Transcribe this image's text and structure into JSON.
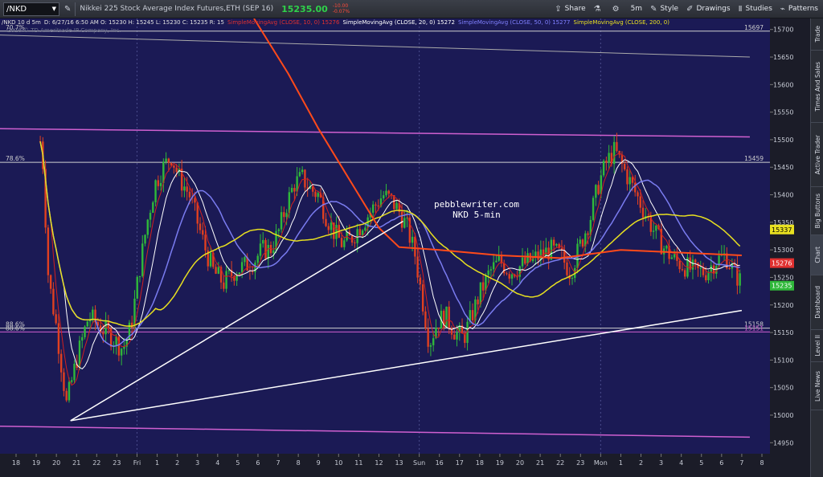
{
  "toolbar": {
    "symbol": "/NKD",
    "description": "Nikkei 225 Stock Average Index Futures,ETH (SEP 16)",
    "last_price": "15235.00",
    "change_abs": "-10.00",
    "change_pct": "-0.07%",
    "buttons": [
      {
        "icon": "share-icon",
        "glyph": "⇪",
        "label": "Share"
      },
      {
        "icon": "flask-icon",
        "glyph": "⚗",
        "label": ""
      },
      {
        "icon": "gear-icon",
        "glyph": "⚙",
        "label": ""
      },
      {
        "icon": "timeframe-icon",
        "glyph": "",
        "label": "5m"
      },
      {
        "icon": "style-icon",
        "glyph": "✎",
        "label": "Style"
      },
      {
        "icon": "drawings-icon",
        "glyph": "✐",
        "label": "Drawings"
      },
      {
        "icon": "studies-icon",
        "glyph": "Ⅱ",
        "label": "Studies"
      },
      {
        "icon": "patterns-icon",
        "glyph": "⌁",
        "label": "Patterns"
      }
    ]
  },
  "side_tabs": [
    "Trade",
    "Times And Sales",
    "Active Trader",
    "Big Buttons",
    "Chart",
    "Dashboard",
    "Level II",
    "Live News"
  ],
  "legend": {
    "prefix": "/NKD 10 d 5m",
    "ohlc": "D: 6/27/16 6:50 AM   O: 15230   H: 15245   L: 15230   C: 15235   R: 15",
    "studies": [
      {
        "label": "SimpleMovingAvg (CLOSE, 10, 0)",
        "value": "15276",
        "color": "#e03030"
      },
      {
        "label": "SimpleMovingAvg (CLOSE, 20, 0)",
        "value": "15272",
        "color": "#ffffff"
      },
      {
        "label": "SimpleMovingAvg (CLOSE, 50, 0)",
        "value": "15277",
        "color": "#8080ff"
      },
      {
        "label": "SimpleMovingAvg (CLOSE, 200, 0)",
        "value": "",
        "color": "#e8e020"
      }
    ],
    "copyright": "2016 © TD Ameritrade IP Company, Inc."
  },
  "watermark": {
    "line1": "pebblewriter.com",
    "line2": "NKD 5-min"
  },
  "colors": {
    "background": "#1b1a55",
    "grid": "#2c2e70",
    "up_candle": "#2fb83a",
    "down_candle": "#e04020",
    "sma200": "#ff4a1a",
    "sma50": "#e8e020",
    "sma20": "#7a7cf0",
    "sma10": "#ffffff",
    "sma5": "#d02020",
    "trendline": "#ffffff",
    "fib": "#aaaaaa",
    "magenta": "#d060d0"
  },
  "chart_data": {
    "type": "candlestick",
    "x_tick_labels": [
      "18",
      "19",
      "20",
      "21",
      "22",
      "23",
      "Fri",
      "1",
      "2",
      "3",
      "4",
      "5",
      "6",
      "7",
      "8",
      "9",
      "10",
      "11",
      "12",
      "13",
      "Sun",
      "16",
      "17",
      "18",
      "19",
      "20",
      "21",
      "22",
      "23",
      "Mon",
      "1",
      "2",
      "3",
      "4",
      "5",
      "6",
      "7",
      "8"
    ],
    "ylim": [
      14930,
      15720
    ],
    "y_ticks": [
      14950,
      15000,
      15050,
      15100,
      15150,
      15200,
      15250,
      15300,
      15350,
      15400,
      15450,
      15500,
      15550,
      15600,
      15650,
      15700
    ],
    "fib_levels": [
      {
        "label": "78.6%",
        "price": 15459,
        "price_label": "15459"
      },
      {
        "label": "88.6%",
        "price": 15158,
        "price_label": "15158"
      },
      {
        "label": "88.6%",
        "price": 15151,
        "price_label": "15151"
      },
      {
        "label": "70.7%",
        "price": 15697,
        "price_label": "15697"
      }
    ],
    "price_tags": [
      {
        "price": 15337,
        "label": "15337",
        "bg": "#e8e020",
        "fg": "#000000"
      },
      {
        "price": 15276,
        "label": "15276",
        "bg": "#e03030",
        "fg": "#ffffff"
      },
      {
        "price": 15235,
        "label": "15235",
        "bg": "#2fb83a",
        "fg": "#ffffff"
      }
    ],
    "price_path": [
      [
        0.0,
        15700
      ],
      [
        1.3,
        15480
      ],
      [
        1.6,
        15250
      ],
      [
        2.0,
        15160
      ],
      [
        2.5,
        15020
      ],
      [
        3.0,
        15100
      ],
      [
        3.6,
        15180
      ],
      [
        4.2,
        15160
      ],
      [
        4.8,
        15140
      ],
      [
        5.3,
        15120
      ],
      [
        5.7,
        15160
      ],
      [
        6.1,
        15260
      ],
      [
        6.5,
        15350
      ],
      [
        6.9,
        15420
      ],
      [
        7.3,
        15450
      ],
      [
        7.7,
        15470
      ],
      [
        8.1,
        15430
      ],
      [
        8.6,
        15400
      ],
      [
        9.0,
        15350
      ],
      [
        9.4,
        15300
      ],
      [
        9.8,
        15260
      ],
      [
        10.3,
        15240
      ],
      [
        10.8,
        15260
      ],
      [
        11.3,
        15270
      ],
      [
        11.8,
        15280
      ],
      [
        12.2,
        15300
      ],
      [
        12.6,
        15300
      ],
      [
        13.0,
        15330
      ],
      [
        13.4,
        15380
      ],
      [
        13.8,
        15420
      ],
      [
        14.2,
        15430
      ],
      [
        14.6,
        15410
      ],
      [
        15.0,
        15400
      ],
      [
        15.4,
        15360
      ],
      [
        15.8,
        15330
      ],
      [
        16.2,
        15310
      ],
      [
        16.6,
        15320
      ],
      [
        17.0,
        15340
      ],
      [
        17.4,
        15360
      ],
      [
        17.8,
        15380
      ],
      [
        18.2,
        15400
      ],
      [
        18.6,
        15390
      ],
      [
        19.0,
        15370
      ],
      [
        19.4,
        15340
      ],
      [
        19.8,
        15290
      ],
      [
        20.2,
        15200
      ],
      [
        20.5,
        15130
      ],
      [
        20.9,
        15170
      ],
      [
        21.3,
        15180
      ],
      [
        21.8,
        15150
      ],
      [
        22.2,
        15140
      ],
      [
        22.6,
        15180
      ],
      [
        23.0,
        15220
      ],
      [
        23.5,
        15260
      ],
      [
        24.0,
        15280
      ],
      [
        24.5,
        15260
      ],
      [
        25.0,
        15270
      ],
      [
        25.5,
        15280
      ],
      [
        26.0,
        15290
      ],
      [
        26.5,
        15300
      ],
      [
        27.0,
        15290
      ],
      [
        27.5,
        15260
      ],
      [
        28.0,
        15310
      ],
      [
        28.5,
        15360
      ],
      [
        28.9,
        15420
      ],
      [
        29.3,
        15460
      ],
      [
        29.7,
        15480
      ],
      [
        30.1,
        15450
      ],
      [
        30.5,
        15420
      ],
      [
        30.9,
        15390
      ],
      [
        31.3,
        15360
      ],
      [
        31.7,
        15330
      ],
      [
        32.2,
        15300
      ],
      [
        32.7,
        15280
      ],
      [
        33.2,
        15270
      ],
      [
        33.7,
        15260
      ],
      [
        34.2,
        15260
      ],
      [
        34.7,
        15280
      ],
      [
        35.2,
        15290
      ],
      [
        35.6,
        15260
      ],
      [
        36.0,
        15240
      ]
    ],
    "trendlines": [
      {
        "from": [
          2.7,
          14990
        ],
        "to": [
          19.2,
          15352
        ]
      },
      {
        "from": [
          2.7,
          14990
        ],
        "to": [
          36.0,
          15190
        ]
      }
    ],
    "horizontal_lines": [
      {
        "from": [
          0,
          15520
        ],
        "to": [
          36.4,
          15505
        ],
        "color": "magenta"
      },
      {
        "from": [
          0,
          15690
        ],
        "to": [
          36.4,
          15650
        ],
        "color": "fib"
      },
      {
        "from": [
          0,
          14980
        ],
        "to": [
          36.4,
          14960
        ],
        "color": "magenta"
      }
    ]
  }
}
